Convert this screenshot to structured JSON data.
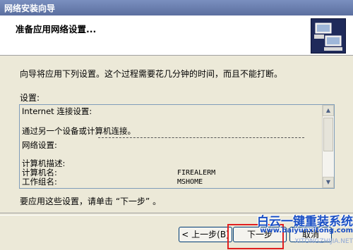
{
  "window": {
    "title": "网络安装向导"
  },
  "header": {
    "heading": "准备应用网络设置..."
  },
  "body": {
    "description": "向导将应用下列设置。这个过程需要花几分钟的时间，而且不能打断。",
    "settings_label": "设置:",
    "settings_lines": [
      "Internet 连接设置:",
      "通过另一个设备或计算机连接。",
      "网络设置:",
      "计算机描述:",
      "计算机名:",
      "工作组名:"
    ],
    "computer_name_value": "FIREALERM",
    "workgroup_value": "MSHOME",
    "hint": "要应用这些设置，请单击 “下一步” 。"
  },
  "buttons": {
    "back": "< 上一步(B)",
    "next": "下一步",
    "cancel": "取消"
  },
  "watermark": {
    "title": "白云一键重装系统",
    "url": "www.baiyunxitong.com",
    "url2": "XITONGZHIJIA.NET"
  },
  "colors": {
    "highlight": "#e02020",
    "title_bar": "#6a7faf",
    "dialog_bg": "#ece9d8"
  },
  "icons": {
    "wizard": "network-computers-icon",
    "scroll_up": "arrow-up-icon",
    "scroll_down": "arrow-down-icon"
  }
}
